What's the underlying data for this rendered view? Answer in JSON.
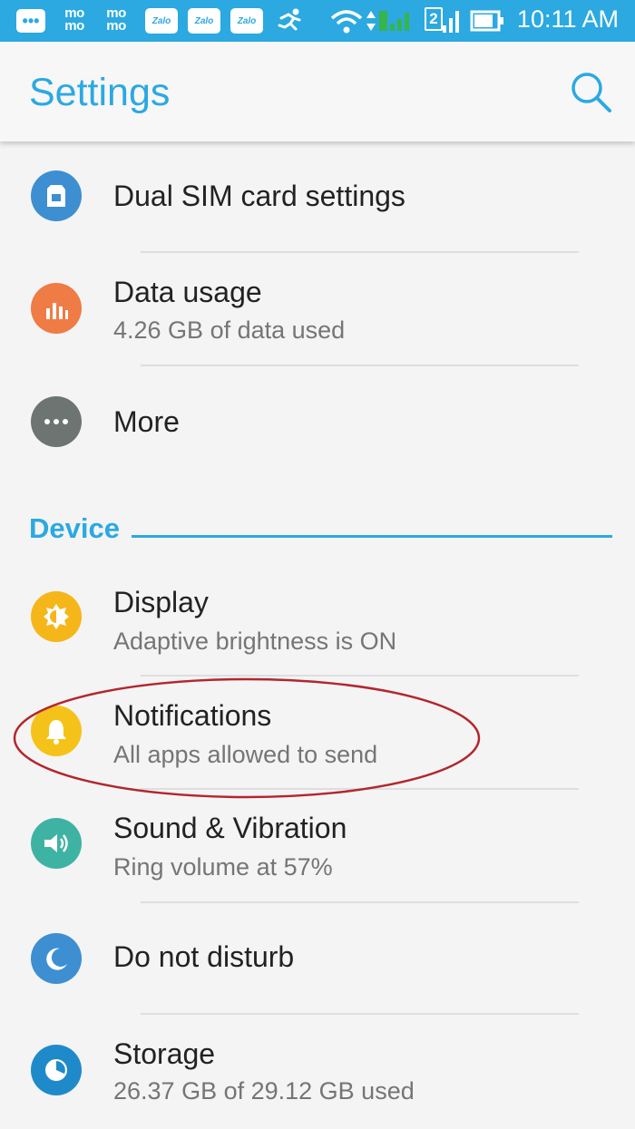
{
  "status_bar": {
    "notification_icons": [
      "chat-icon",
      "momo-icon",
      "momo-icon",
      "zalo-icon",
      "zalo-icon",
      "zalo-icon",
      "runner-icon"
    ],
    "momo_label": "mo\nmo",
    "zalo_label": "Zalo",
    "sim2_label": "2",
    "time": "10:11 AM"
  },
  "app_bar": {
    "title": "Settings",
    "search_icon": "search-icon"
  },
  "items_top": [
    {
      "title": "Dual SIM card settings",
      "subtitle": "",
      "icon": "sim-card-icon",
      "color": "#3d8fd1"
    },
    {
      "title": "Data usage",
      "subtitle": "4.26 GB of data used",
      "icon": "bar-chart-icon",
      "color": "#ef7b45"
    },
    {
      "title": "More",
      "subtitle": "",
      "icon": "more-dots-icon",
      "color": "#6d7471"
    }
  ],
  "section": {
    "title": "Device"
  },
  "items_device": [
    {
      "title": "Display",
      "subtitle": "Adaptive brightness is ON",
      "icon": "brightness-icon",
      "color": "#f5b61a"
    },
    {
      "title": "Notifications",
      "subtitle": "All apps allowed to send",
      "icon": "bell-icon",
      "color": "#f5c21a"
    },
    {
      "title": "Sound & Vibration",
      "subtitle": "Ring volume at 57%",
      "icon": "speaker-icon",
      "color": "#3fb3a3"
    },
    {
      "title": "Do not disturb",
      "subtitle": "",
      "icon": "moon-icon",
      "color": "#3d8fd1"
    },
    {
      "title": "Storage",
      "subtitle": "26.37 GB of 29.12 GB used",
      "icon": "storage-clock-icon",
      "color": "#1f8ac9"
    }
  ],
  "colors": {
    "accent": "#2ba9e0",
    "highlight_ellipse": "#b3262e"
  }
}
